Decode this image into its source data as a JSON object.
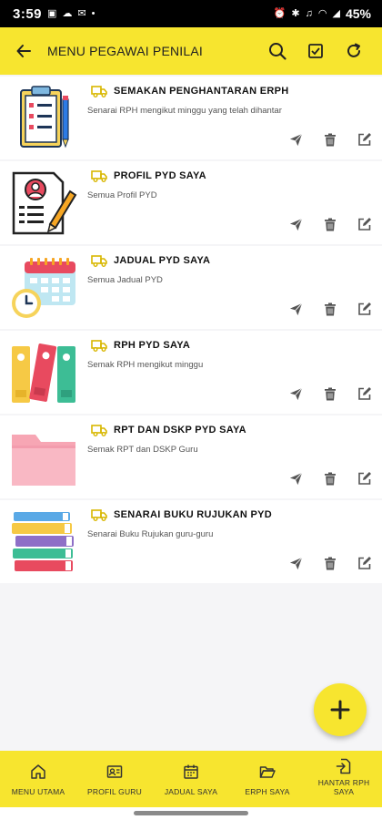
{
  "status_bar": {
    "time": "3:59",
    "battery": "45%"
  },
  "app_bar": {
    "title": "MENU PEGAWAI PENILAI"
  },
  "cards": [
    {
      "title": "SEMAKAN PENGHANTARAN ERPH",
      "subtitle": "Senarai RPH mengikut minggu yang telah dihantar",
      "image": "clipboard-checklist"
    },
    {
      "title": "PROFIL PYD SAYA",
      "subtitle": "Semua Profil PYD",
      "image": "profile-document"
    },
    {
      "title": "JADUAL PYD SAYA",
      "subtitle": "Semua Jadual PYD",
      "image": "calendar-clock"
    },
    {
      "title": "RPH PYD SAYA",
      "subtitle": "Semak RPH mengikut minggu",
      "image": "binders"
    },
    {
      "title": "RPT DAN DSKP PYD SAYA",
      "subtitle": "Semak RPT dan DSKP Guru",
      "image": "pink-folder"
    },
    {
      "title": "SENARAI BUKU RUJUKAN PYD",
      "subtitle": "Senarai Buku Rujukan guru-guru",
      "image": "book-stack"
    }
  ],
  "bottom_nav": [
    {
      "label": "MENU UTAMA",
      "icon": "home-icon"
    },
    {
      "label": "PROFIL GURU",
      "icon": "id-card-icon"
    },
    {
      "label": "JADUAL SAYA",
      "icon": "calendar-icon"
    },
    {
      "label": "ERPH SAYA",
      "icon": "folder-open-icon"
    },
    {
      "label": "HANTAR RPH SAYA",
      "icon": "send-document-icon"
    }
  ],
  "colors": {
    "accent": "#f7e52f",
    "background": "#f5f5f7"
  }
}
